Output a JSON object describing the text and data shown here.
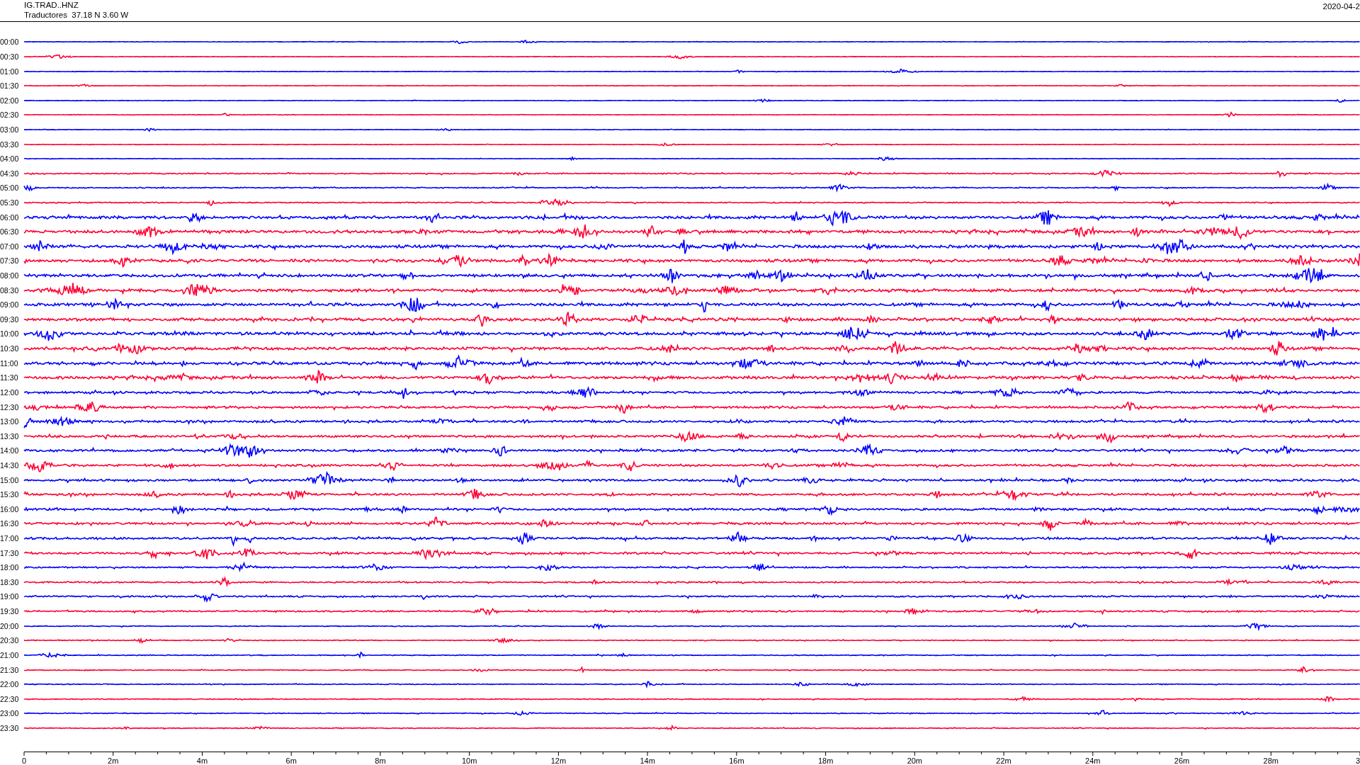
{
  "header": {
    "station": "IG.TRAD..HNZ",
    "location": "Traductores  37.18 N 3.60 W",
    "date": "2020-04-2"
  },
  "rows": [
    {
      "time": "00:00",
      "color": "#0000ff"
    },
    {
      "time": "00:30",
      "color": "#ff0033"
    },
    {
      "time": "01:00",
      "color": "#0000ff"
    },
    {
      "time": "01:30",
      "color": "#ff0033"
    },
    {
      "time": "02:00",
      "color": "#0000ff"
    },
    {
      "time": "02:30",
      "color": "#ff0033"
    },
    {
      "time": "03:00",
      "color": "#0000ff"
    },
    {
      "time": "03:30",
      "color": "#ff0033"
    },
    {
      "time": "04:00",
      "color": "#0000ff"
    },
    {
      "time": "04:30",
      "color": "#ff0033"
    },
    {
      "time": "05:00",
      "color": "#0000ff"
    },
    {
      "time": "05:30",
      "color": "#ff0033"
    },
    {
      "time": "06:00",
      "color": "#0000ff"
    },
    {
      "time": "06:30",
      "color": "#ff0033"
    },
    {
      "time": "07:00",
      "color": "#0000ff"
    },
    {
      "time": "07:30",
      "color": "#ff0033"
    },
    {
      "time": "08:00",
      "color": "#0000ff"
    },
    {
      "time": "08:30",
      "color": "#ff0033"
    },
    {
      "time": "09:00",
      "color": "#0000ff"
    },
    {
      "time": "09:30",
      "color": "#ff0033"
    },
    {
      "time": "10:00",
      "color": "#0000ff"
    },
    {
      "time": "10:30",
      "color": "#ff0033"
    },
    {
      "time": "11:00",
      "color": "#0000ff"
    },
    {
      "time": "11:30",
      "color": "#ff0033"
    },
    {
      "time": "12:00",
      "color": "#0000ff"
    },
    {
      "time": "12:30",
      "color": "#ff0033"
    },
    {
      "time": "13:00",
      "color": "#0000ff"
    },
    {
      "time": "13:30",
      "color": "#ff0033"
    },
    {
      "time": "14:00",
      "color": "#0000ff"
    },
    {
      "time": "14:30",
      "color": "#ff0033"
    },
    {
      "time": "15:00",
      "color": "#0000ff"
    },
    {
      "time": "15:30",
      "color": "#ff0033"
    },
    {
      "time": "16:00",
      "color": "#0000ff"
    },
    {
      "time": "16:30",
      "color": "#ff0033"
    },
    {
      "time": "17:00",
      "color": "#0000ff"
    },
    {
      "time": "17:30",
      "color": "#ff0033"
    },
    {
      "time": "18:00",
      "color": "#0000ff"
    },
    {
      "time": "18:30",
      "color": "#ff0033"
    },
    {
      "time": "19:00",
      "color": "#0000ff"
    },
    {
      "time": "19:30",
      "color": "#ff0033"
    },
    {
      "time": "20:00",
      "color": "#0000ff"
    },
    {
      "time": "20:30",
      "color": "#ff0033"
    },
    {
      "time": "21:00",
      "color": "#0000ff"
    },
    {
      "time": "21:30",
      "color": "#ff0033"
    },
    {
      "time": "22:00",
      "color": "#0000ff"
    },
    {
      "time": "22:30",
      "color": "#ff0033"
    },
    {
      "time": "23:00",
      "color": "#0000ff"
    },
    {
      "time": "23:30",
      "color": "#ff0033"
    }
  ],
  "x_axis": {
    "ticks": [
      "0",
      "2m",
      "4m",
      "6m",
      "8m",
      "10m",
      "12m",
      "14m",
      "16m",
      "18m",
      "20m",
      "22m",
      "24m",
      "26m",
      "28m",
      "3"
    ]
  }
}
